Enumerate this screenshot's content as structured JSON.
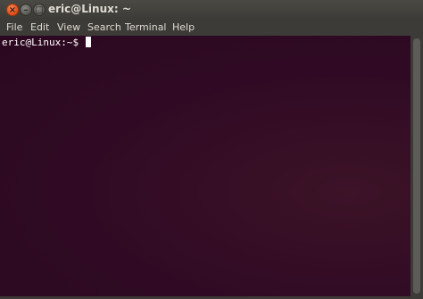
{
  "window": {
    "title": "eric@Linux: ~",
    "buttons": {
      "close_icon": "close-icon",
      "minimize_icon": "minimize-icon",
      "maximize_icon": "maximize-icon"
    }
  },
  "menubar": {
    "items": [
      "File",
      "Edit",
      "View",
      "Search",
      "Terminal",
      "Help"
    ]
  },
  "terminal": {
    "prompt": "eric@Linux:~$ ",
    "background_color": "#300a24",
    "text_color": "#ffffff"
  }
}
